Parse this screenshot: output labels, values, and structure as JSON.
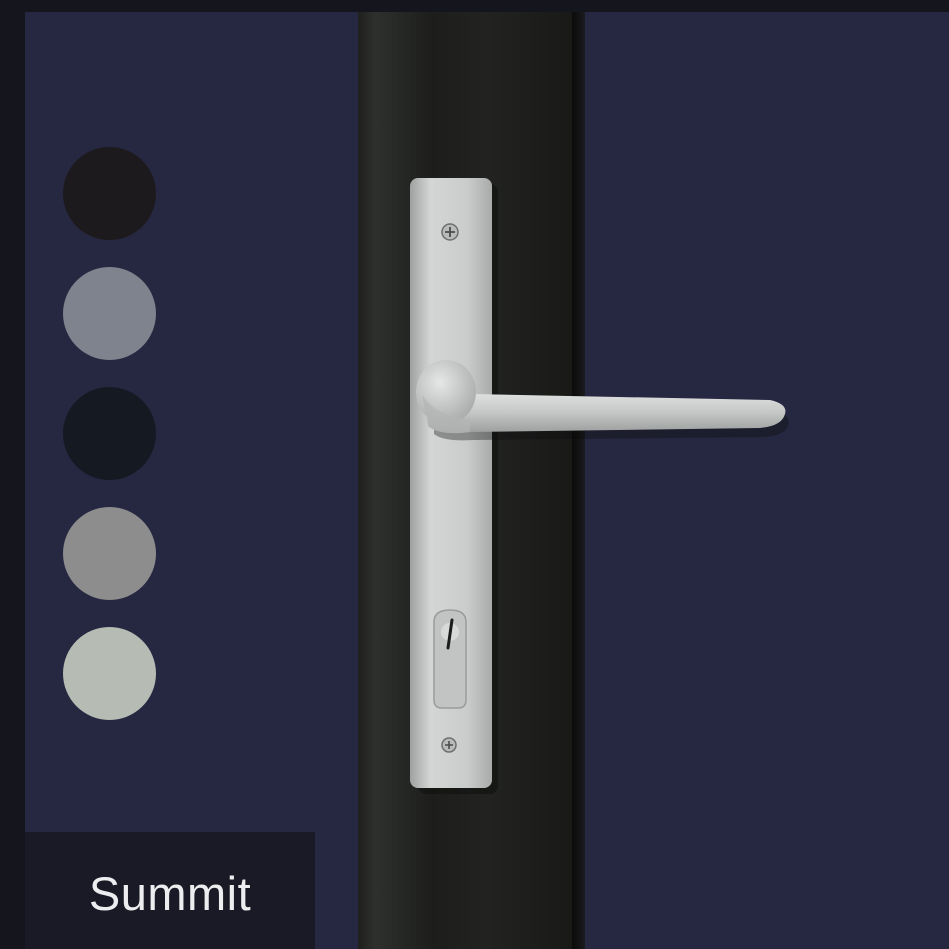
{
  "product": {
    "finish_label": "Summit"
  },
  "swatches": [
    {
      "color": "#1c1a1c",
      "name": "black"
    },
    {
      "color": "#7e838e",
      "name": "silver-grey"
    },
    {
      "color": "#151922",
      "name": "dark-charcoal"
    },
    {
      "color": "#8d8d8e",
      "name": "grey"
    },
    {
      "color": "#b6bbb3",
      "name": "summit"
    }
  ],
  "colors": {
    "background": "#262740",
    "frame": "#1f201e",
    "handle": "#c9cbcb",
    "label_bg": "#191a25"
  }
}
